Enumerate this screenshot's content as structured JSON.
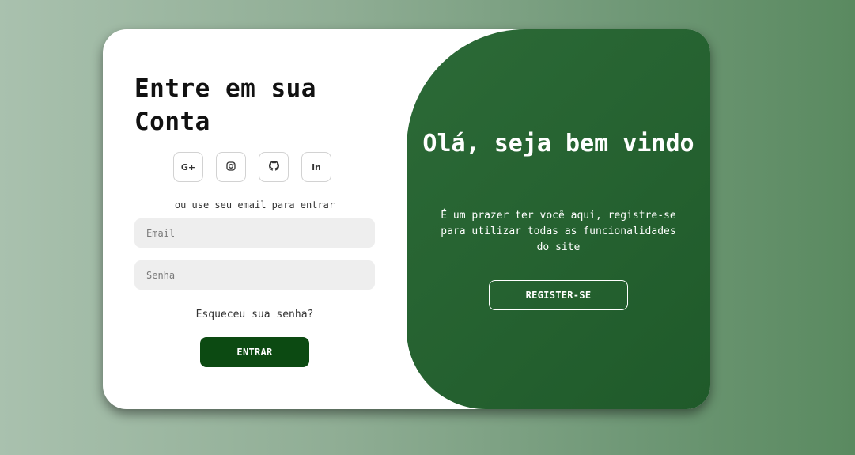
{
  "login": {
    "title": "Entre em sua Conta",
    "social": [
      {
        "icon": "google-plus-icon",
        "glyph": "G+"
      },
      {
        "icon": "instagram-icon",
        "glyph": ""
      },
      {
        "icon": "github-icon",
        "glyph": ""
      },
      {
        "icon": "linkedin-icon",
        "glyph": "in"
      }
    ],
    "alt_text": "ou use seu email para entrar",
    "email_placeholder": "Email",
    "password_placeholder": "Senha",
    "forgot_label": "Esqueceu sua senha?",
    "submit_label": "ENTRAR"
  },
  "panel": {
    "title": "Olá, seja bem vindo",
    "description": "É um prazer ter você aqui, registre-se para utilizar todas as funcionalidades do site",
    "register_label": "REGISTER-SE"
  },
  "colors": {
    "primary_dark": "#0c4a12",
    "panel_green": "#245f2f",
    "input_bg": "#eeeeee"
  }
}
